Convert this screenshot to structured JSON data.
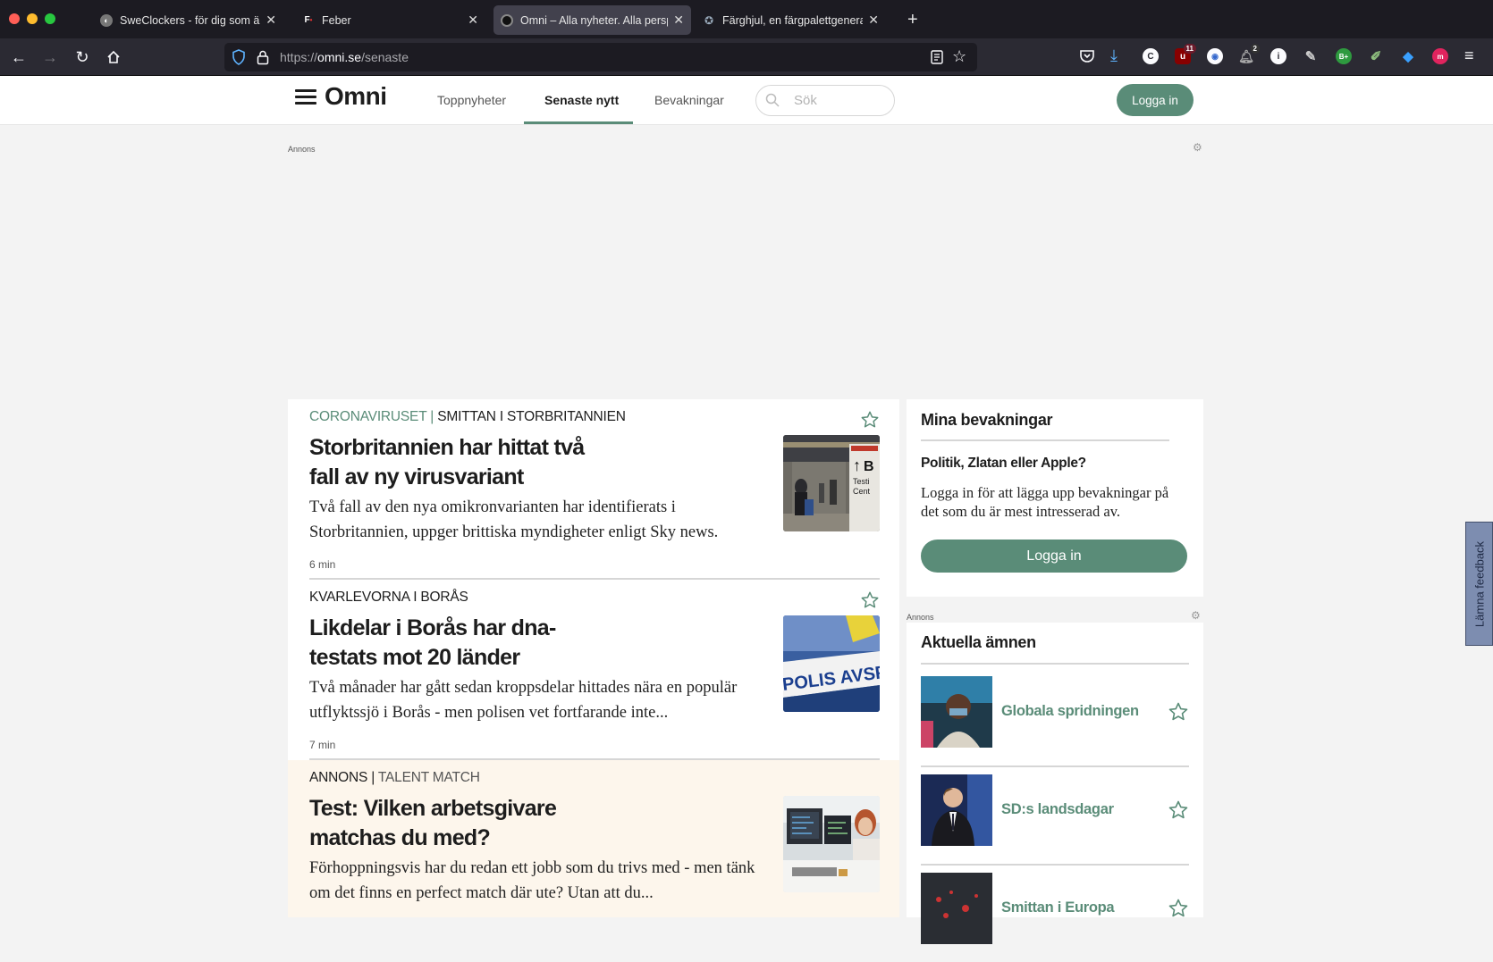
{
  "browser": {
    "tabs": [
      {
        "title": "SweClockers - för dig som älskar teknik",
        "favicon": "sweclockers-icon",
        "active": false
      },
      {
        "title": "Feber",
        "favicon": "feber-icon",
        "active": false
      },
      {
        "title": "Omni – Alla nyheter. Alla perspektiv.",
        "favicon": "omni-icon",
        "active": true
      },
      {
        "title": "Färghjul, en färgpalettgenerator",
        "favicon": "colorwheel-icon",
        "active": false
      }
    ],
    "new_tab": "+",
    "url_prefix": "https://",
    "url_host": "omni.se",
    "url_path": "/senaste",
    "extension_badges": {
      "ublock": "11",
      "notifications": "2"
    }
  },
  "site": {
    "logo": "Omni",
    "nav": [
      "Toppnyheter",
      "Senaste nytt",
      "Bevakningar"
    ],
    "active_nav": "Senaste nytt",
    "search_placeholder": "Sök",
    "login_label": "Logga in",
    "ad_label": "Annons",
    "accent_color": "#5a8c78"
  },
  "articles": [
    {
      "topic": "CORONAVIRUSET",
      "separator": "|",
      "subtopic": "SMITTAN I STORBRITANNIEN",
      "title": "Storbritannien har hittat två fall av ny virusvariant",
      "description": "Två fall av den nya omikronvarianten har identifierats i Storbritannien, uppger brittiska myndigheter enligt Sky news.",
      "read_time": "6 min",
      "image": "airport-photo"
    },
    {
      "topic": "",
      "separator": "",
      "subtopic": "KVARLEVORNA I BORÅS",
      "title": "Likdelar i Borås har dna-testats mot 20 länder",
      "description": "Två månader har gått sedan kroppsdelar hittades nära en populär utflyktssjö i Borås - men polisen vet fortfarande inte...",
      "read_time": "7 min",
      "image": "police-tape-photo",
      "image_text": "POLIS AVSPÄRRAT"
    },
    {
      "topic": "ANNONS",
      "separator": "|",
      "subtopic": "TALENT MATCH",
      "title": "Test: Vilken arbetsgivare matchas du med?",
      "description": "Förhoppningsvis har du redan ett jobb som du trivs med - men tänk om det finns en perfect match där ute? Utan att du...",
      "read_time": "",
      "image": "office-photo",
      "sponsored": true
    }
  ],
  "sidebar": {
    "watch": {
      "heading": "Mina bevakningar",
      "question": "Politik, Zlatan eller Apple?",
      "text": "Logga in för att lägga upp bevakningar på det som du är mest intresserad av.",
      "button": "Logga in"
    },
    "ad_label": "Annons",
    "topics": {
      "heading": "Aktuella ämnen",
      "items": [
        {
          "name": "Globala spridningen",
          "image": "vaccination-photo"
        },
        {
          "name": "SD:s landsdagar",
          "image": "speaker-photo"
        },
        {
          "name": "Smittan i Europa",
          "image": "map-photo"
        }
      ]
    }
  },
  "feedback": "Lämna feedback"
}
